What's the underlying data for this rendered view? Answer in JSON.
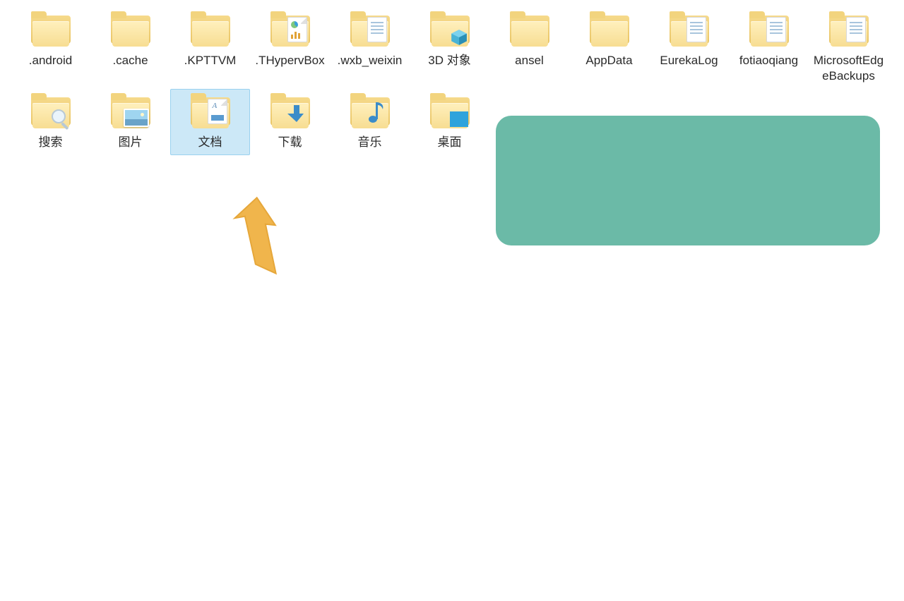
{
  "folders_row1": [
    {
      "label": ".android",
      "name": "folder-android",
      "icon": "plain"
    },
    {
      "label": ".cache",
      "name": "folder-cache",
      "icon": "plain"
    },
    {
      "label": ".KPTTVM",
      "name": "folder-kpttvm",
      "icon": "plain"
    },
    {
      "label": ".THypervBox",
      "name": "folder-thypervbox",
      "icon": "chart"
    },
    {
      "label": ".wxb_weixin",
      "name": "folder-wxb-weixin",
      "icon": "text"
    },
    {
      "label": "3D 对象",
      "name": "folder-3d-objects",
      "icon": "cube"
    },
    {
      "label": "ansel",
      "name": "folder-ansel",
      "icon": "plain"
    },
    {
      "label": "AppData",
      "name": "folder-appdata",
      "icon": "plain"
    },
    {
      "label": "EurekaLog",
      "name": "folder-eurekalog",
      "icon": "text"
    },
    {
      "label": "fotiaoqiang",
      "name": "folder-fotiaoqiang",
      "icon": "text"
    },
    {
      "label": "MicrosoftEdgeBackups",
      "name": "folder-msedge-backups",
      "icon": "text"
    }
  ],
  "folders_row2": [
    {
      "label": "搜索",
      "name": "folder-searches",
      "icon": "search"
    },
    {
      "label": "图片",
      "name": "folder-pictures",
      "icon": "photo"
    },
    {
      "label": "文档",
      "name": "folder-documents",
      "icon": "doc",
      "selected": true
    },
    {
      "label": "下载",
      "name": "folder-downloads",
      "icon": "download"
    },
    {
      "label": "音乐",
      "name": "folder-music",
      "icon": "music"
    },
    {
      "label": "桌面",
      "name": "folder-desktop",
      "icon": "desktop"
    }
  ]
}
